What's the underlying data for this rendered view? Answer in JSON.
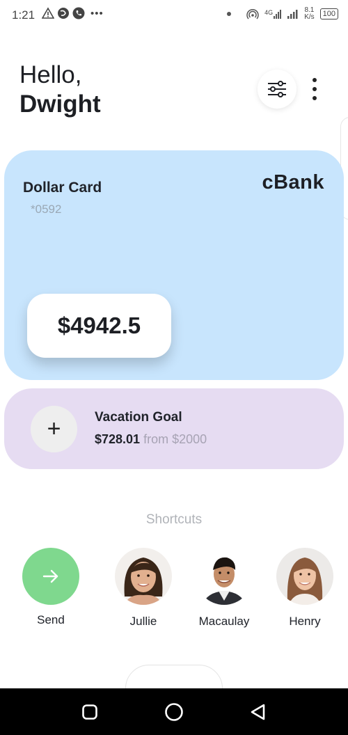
{
  "status_bar": {
    "time": "1:21",
    "more_label": "•••",
    "network": "4G",
    "speed_value": "8.1",
    "speed_unit": "K/s",
    "battery": "100"
  },
  "header": {
    "greeting": "Hello,",
    "user_name": "Dwight"
  },
  "card": {
    "title": "Dollar Card",
    "number": "*0592",
    "bank": "cBank",
    "balance": "$4942.5",
    "color": "#c8e5fd"
  },
  "goal": {
    "title": "Vacation Goal",
    "amount": "$728.01",
    "target": "from $2000",
    "add_label": "+",
    "color": "#e6dcf2"
  },
  "shortcuts": {
    "title": "Shortcuts",
    "items": [
      {
        "label": "Send",
        "icon": "arrow-right-icon",
        "color": "#7fd88e"
      },
      {
        "label": "Jullie",
        "icon": "avatar"
      },
      {
        "label": "Macaulay",
        "icon": "avatar"
      },
      {
        "label": "Henry",
        "icon": "avatar"
      }
    ]
  },
  "nav": {
    "icons": [
      "recent-apps-icon",
      "home-icon",
      "back-icon"
    ]
  }
}
